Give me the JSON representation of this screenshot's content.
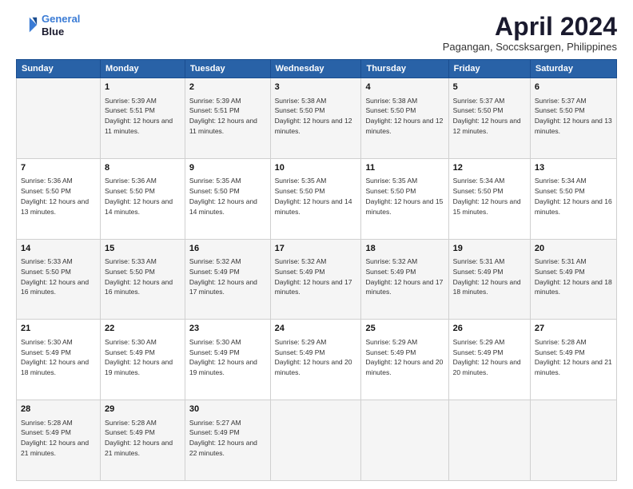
{
  "logo": {
    "line1": "General",
    "line2": "Blue"
  },
  "title": "April 2024",
  "location": "Pagangan, Soccsksargen, Philippines",
  "weekdays": [
    "Sunday",
    "Monday",
    "Tuesday",
    "Wednesday",
    "Thursday",
    "Friday",
    "Saturday"
  ],
  "weeks": [
    [
      {
        "day": "",
        "sunrise": "",
        "sunset": "",
        "daylight": ""
      },
      {
        "day": "1",
        "sunrise": "Sunrise: 5:39 AM",
        "sunset": "Sunset: 5:51 PM",
        "daylight": "Daylight: 12 hours and 11 minutes."
      },
      {
        "day": "2",
        "sunrise": "Sunrise: 5:39 AM",
        "sunset": "Sunset: 5:51 PM",
        "daylight": "Daylight: 12 hours and 11 minutes."
      },
      {
        "day": "3",
        "sunrise": "Sunrise: 5:38 AM",
        "sunset": "Sunset: 5:50 PM",
        "daylight": "Daylight: 12 hours and 12 minutes."
      },
      {
        "day": "4",
        "sunrise": "Sunrise: 5:38 AM",
        "sunset": "Sunset: 5:50 PM",
        "daylight": "Daylight: 12 hours and 12 minutes."
      },
      {
        "day": "5",
        "sunrise": "Sunrise: 5:37 AM",
        "sunset": "Sunset: 5:50 PM",
        "daylight": "Daylight: 12 hours and 12 minutes."
      },
      {
        "day": "6",
        "sunrise": "Sunrise: 5:37 AM",
        "sunset": "Sunset: 5:50 PM",
        "daylight": "Daylight: 12 hours and 13 minutes."
      }
    ],
    [
      {
        "day": "7",
        "sunrise": "Sunrise: 5:36 AM",
        "sunset": "Sunset: 5:50 PM",
        "daylight": "Daylight: 12 hours and 13 minutes."
      },
      {
        "day": "8",
        "sunrise": "Sunrise: 5:36 AM",
        "sunset": "Sunset: 5:50 PM",
        "daylight": "Daylight: 12 hours and 14 minutes."
      },
      {
        "day": "9",
        "sunrise": "Sunrise: 5:35 AM",
        "sunset": "Sunset: 5:50 PM",
        "daylight": "Daylight: 12 hours and 14 minutes."
      },
      {
        "day": "10",
        "sunrise": "Sunrise: 5:35 AM",
        "sunset": "Sunset: 5:50 PM",
        "daylight": "Daylight: 12 hours and 14 minutes."
      },
      {
        "day": "11",
        "sunrise": "Sunrise: 5:35 AM",
        "sunset": "Sunset: 5:50 PM",
        "daylight": "Daylight: 12 hours and 15 minutes."
      },
      {
        "day": "12",
        "sunrise": "Sunrise: 5:34 AM",
        "sunset": "Sunset: 5:50 PM",
        "daylight": "Daylight: 12 hours and 15 minutes."
      },
      {
        "day": "13",
        "sunrise": "Sunrise: 5:34 AM",
        "sunset": "Sunset: 5:50 PM",
        "daylight": "Daylight: 12 hours and 16 minutes."
      }
    ],
    [
      {
        "day": "14",
        "sunrise": "Sunrise: 5:33 AM",
        "sunset": "Sunset: 5:50 PM",
        "daylight": "Daylight: 12 hours and 16 minutes."
      },
      {
        "day": "15",
        "sunrise": "Sunrise: 5:33 AM",
        "sunset": "Sunset: 5:50 PM",
        "daylight": "Daylight: 12 hours and 16 minutes."
      },
      {
        "day": "16",
        "sunrise": "Sunrise: 5:32 AM",
        "sunset": "Sunset: 5:49 PM",
        "daylight": "Daylight: 12 hours and 17 minutes."
      },
      {
        "day": "17",
        "sunrise": "Sunrise: 5:32 AM",
        "sunset": "Sunset: 5:49 PM",
        "daylight": "Daylight: 12 hours and 17 minutes."
      },
      {
        "day": "18",
        "sunrise": "Sunrise: 5:32 AM",
        "sunset": "Sunset: 5:49 PM",
        "daylight": "Daylight: 12 hours and 17 minutes."
      },
      {
        "day": "19",
        "sunrise": "Sunrise: 5:31 AM",
        "sunset": "Sunset: 5:49 PM",
        "daylight": "Daylight: 12 hours and 18 minutes."
      },
      {
        "day": "20",
        "sunrise": "Sunrise: 5:31 AM",
        "sunset": "Sunset: 5:49 PM",
        "daylight": "Daylight: 12 hours and 18 minutes."
      }
    ],
    [
      {
        "day": "21",
        "sunrise": "Sunrise: 5:30 AM",
        "sunset": "Sunset: 5:49 PM",
        "daylight": "Daylight: 12 hours and 18 minutes."
      },
      {
        "day": "22",
        "sunrise": "Sunrise: 5:30 AM",
        "sunset": "Sunset: 5:49 PM",
        "daylight": "Daylight: 12 hours and 19 minutes."
      },
      {
        "day": "23",
        "sunrise": "Sunrise: 5:30 AM",
        "sunset": "Sunset: 5:49 PM",
        "daylight": "Daylight: 12 hours and 19 minutes."
      },
      {
        "day": "24",
        "sunrise": "Sunrise: 5:29 AM",
        "sunset": "Sunset: 5:49 PM",
        "daylight": "Daylight: 12 hours and 20 minutes."
      },
      {
        "day": "25",
        "sunrise": "Sunrise: 5:29 AM",
        "sunset": "Sunset: 5:49 PM",
        "daylight": "Daylight: 12 hours and 20 minutes."
      },
      {
        "day": "26",
        "sunrise": "Sunrise: 5:29 AM",
        "sunset": "Sunset: 5:49 PM",
        "daylight": "Daylight: 12 hours and 20 minutes."
      },
      {
        "day": "27",
        "sunrise": "Sunrise: 5:28 AM",
        "sunset": "Sunset: 5:49 PM",
        "daylight": "Daylight: 12 hours and 21 minutes."
      }
    ],
    [
      {
        "day": "28",
        "sunrise": "Sunrise: 5:28 AM",
        "sunset": "Sunset: 5:49 PM",
        "daylight": "Daylight: 12 hours and 21 minutes."
      },
      {
        "day": "29",
        "sunrise": "Sunrise: 5:28 AM",
        "sunset": "Sunset: 5:49 PM",
        "daylight": "Daylight: 12 hours and 21 minutes."
      },
      {
        "day": "30",
        "sunrise": "Sunrise: 5:27 AM",
        "sunset": "Sunset: 5:49 PM",
        "daylight": "Daylight: 12 hours and 22 minutes."
      },
      {
        "day": "",
        "sunrise": "",
        "sunset": "",
        "daylight": ""
      },
      {
        "day": "",
        "sunrise": "",
        "sunset": "",
        "daylight": ""
      },
      {
        "day": "",
        "sunrise": "",
        "sunset": "",
        "daylight": ""
      },
      {
        "day": "",
        "sunrise": "",
        "sunset": "",
        "daylight": ""
      }
    ]
  ]
}
